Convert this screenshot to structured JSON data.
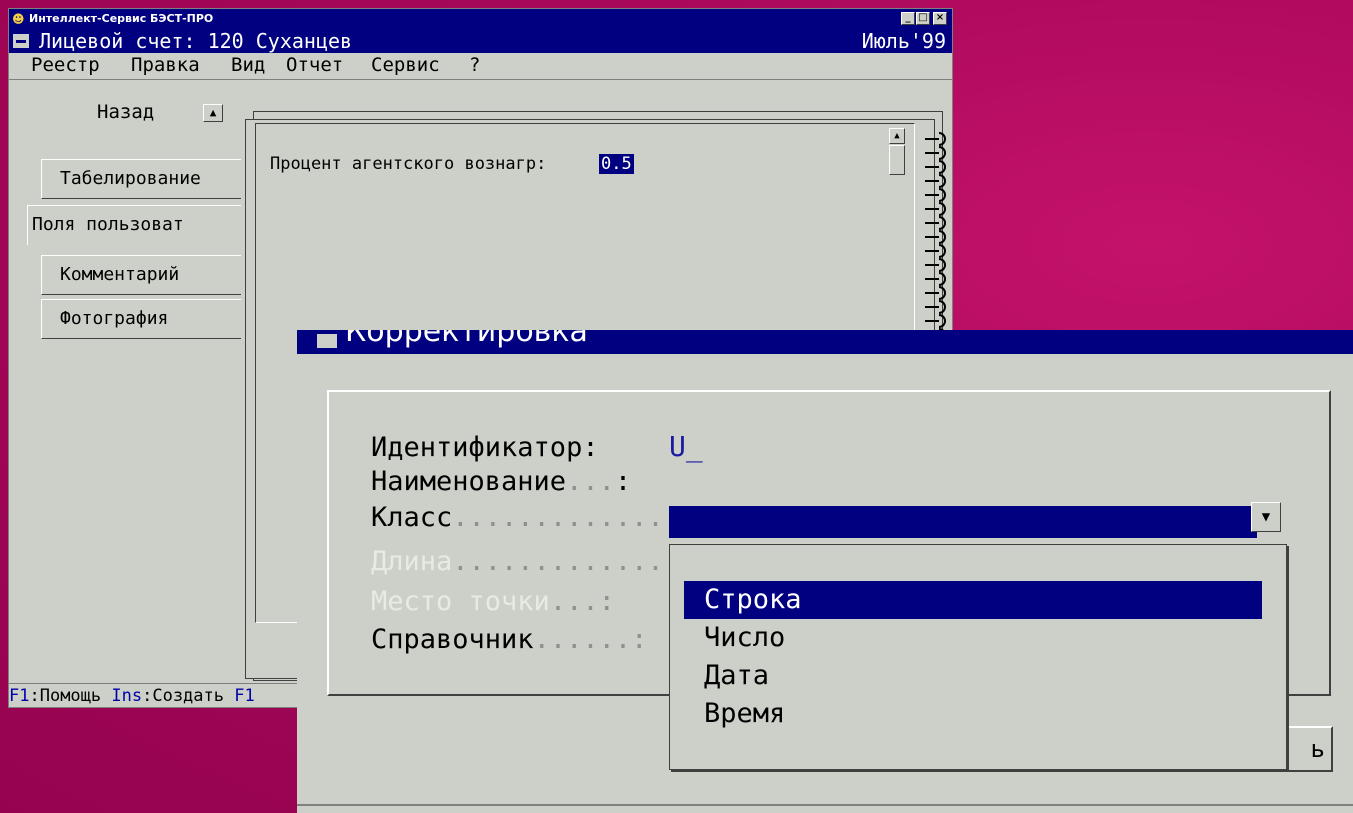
{
  "app": {
    "title": "Интеллект-Сервис БЭСТ-ПРО",
    "window_buttons": {
      "minimize": "_",
      "maximize": "□",
      "close": "×"
    }
  },
  "document": {
    "title": "Лицевой счет: 120 Суханцев",
    "period": "Июль'99"
  },
  "menu": [
    "Реестр",
    "Правка",
    "Вид",
    "Отчет",
    "Сервис",
    "?"
  ],
  "nav": {
    "back_label": "Назад"
  },
  "tabs": [
    "Табелирование",
    "Поля пользоват",
    "Комментарий",
    "Фотография"
  ],
  "active_tab": "Поля пользоват",
  "field": {
    "label": "Процент агентского вознагр:",
    "value": "0.5"
  },
  "statusbar": {
    "items": [
      {
        "key": "F1",
        "label": ":Помощь"
      },
      {
        "key": "Ins",
        "label": ":Создать"
      },
      {
        "key": "F1",
        "label": ""
      }
    ]
  },
  "dialog": {
    "title": "Корректировка",
    "labels": {
      "identifier": "Идентификатор:",
      "name": "Наименование",
      "class": "Класс",
      "length": "Длина",
      "decimal_place": "Место точки",
      "reference": "Справочник"
    },
    "identifier_value": "U_",
    "class_options": [
      "Строка",
      "Число",
      "Дата",
      "Время"
    ],
    "selected_option": "Строка",
    "visible_button_fragment": "ь"
  },
  "colors": {
    "background": "#a8085a",
    "window": "#cdd0c8",
    "titlebar": "#000080",
    "key_text": "#0000a8"
  }
}
